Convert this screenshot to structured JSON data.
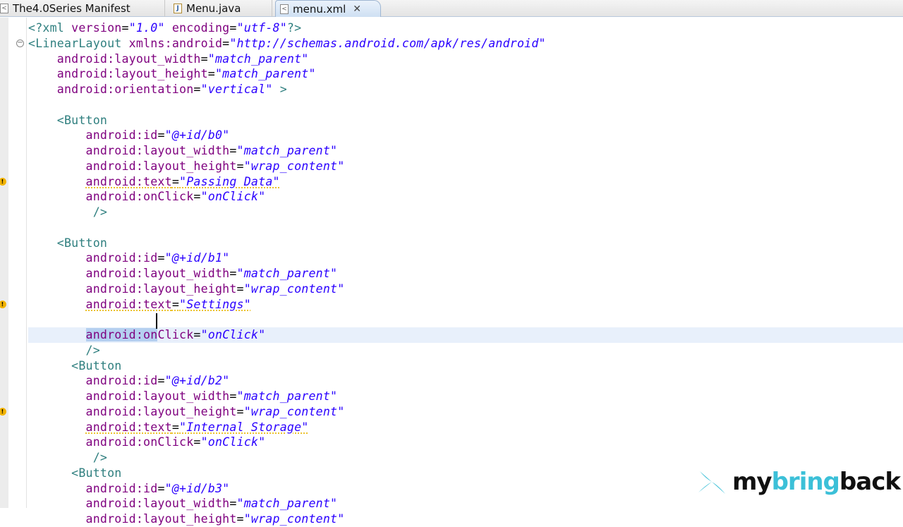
{
  "tabs": [
    {
      "label": "The4.0Series Manifest",
      "icon": "xml-file-icon"
    },
    {
      "label": "Menu.java",
      "icon": "java-file-icon"
    },
    {
      "label": "menu.xml",
      "icon": "xml-file-icon",
      "active": true
    }
  ],
  "logo": {
    "pre": "my",
    "mid": "bring",
    "post": "back"
  },
  "current_line": 20,
  "warning_lines": [
    10,
    18,
    25
  ],
  "code": [
    [
      [
        "tag",
        "<?xml "
      ],
      [
        "attr",
        "version"
      ],
      [
        "eq",
        "="
      ],
      [
        "val",
        "\"1.0\""
      ],
      [
        "attr",
        " encoding"
      ],
      [
        "eq",
        "="
      ],
      [
        "val",
        "\"utf-8\""
      ],
      [
        "tag",
        "?>"
      ]
    ],
    [
      [
        "tag",
        "<LinearLayout "
      ],
      [
        "attr",
        "xmlns:android"
      ],
      [
        "eq",
        "="
      ],
      [
        "val",
        "\"http://schemas.android.com/apk/res/android\""
      ]
    ],
    [
      [
        "sp",
        "    "
      ],
      [
        "attr",
        "android:layout_width"
      ],
      [
        "eq",
        "="
      ],
      [
        "val",
        "\"match_parent\""
      ]
    ],
    [
      [
        "sp",
        "    "
      ],
      [
        "attr",
        "android:layout_height"
      ],
      [
        "eq",
        "="
      ],
      [
        "val",
        "\"match_parent\""
      ]
    ],
    [
      [
        "sp",
        "    "
      ],
      [
        "attr",
        "android:orientation"
      ],
      [
        "eq",
        "="
      ],
      [
        "val",
        "\"vertical\""
      ],
      [
        "tag",
        " >"
      ]
    ],
    [],
    [
      [
        "sp",
        "    "
      ],
      [
        "tag",
        "<Button"
      ]
    ],
    [
      [
        "sp",
        "        "
      ],
      [
        "attr",
        "android:id"
      ],
      [
        "eq",
        "="
      ],
      [
        "val",
        "\"@+id/b0\""
      ]
    ],
    [
      [
        "sp",
        "        "
      ],
      [
        "attr",
        "android:layout_width"
      ],
      [
        "eq",
        "="
      ],
      [
        "val",
        "\"match_parent\""
      ]
    ],
    [
      [
        "sp",
        "        "
      ],
      [
        "attr",
        "android:layout_height"
      ],
      [
        "eq",
        "="
      ],
      [
        "val",
        "\"wrap_content\""
      ]
    ],
    [
      [
        "sp",
        "        "
      ],
      [
        "attrw",
        "android:text"
      ],
      [
        "eqw",
        "="
      ],
      [
        "valw",
        "\"Passing Data\""
      ]
    ],
    [
      [
        "sp",
        "        "
      ],
      [
        "attr",
        "android:onClick"
      ],
      [
        "eq",
        "="
      ],
      [
        "val",
        "\"onClick\""
      ]
    ],
    [
      [
        "sp",
        "         "
      ],
      [
        "tag",
        "/>"
      ]
    ],
    [],
    [
      [
        "sp",
        "    "
      ],
      [
        "tag",
        "<Button"
      ]
    ],
    [
      [
        "sp",
        "        "
      ],
      [
        "attr",
        "android:id"
      ],
      [
        "eq",
        "="
      ],
      [
        "val",
        "\"@+id/b1\""
      ]
    ],
    [
      [
        "sp",
        "        "
      ],
      [
        "attr",
        "android:layout_width"
      ],
      [
        "eq",
        "="
      ],
      [
        "val",
        "\"match_parent\""
      ]
    ],
    [
      [
        "sp",
        "        "
      ],
      [
        "attr",
        "android:layout_height"
      ],
      [
        "eq",
        "="
      ],
      [
        "val",
        "\"wrap_content\""
      ]
    ],
    [
      [
        "sp",
        "        "
      ],
      [
        "attrw",
        "android:text"
      ],
      [
        "eqw",
        "="
      ],
      [
        "valw",
        "\"Settings\""
      ]
    ],
    [],
    [
      [
        "sp",
        "        "
      ],
      [
        "sel",
        "android:on"
      ],
      [
        "attr",
        "Click"
      ],
      [
        "eq",
        "="
      ],
      [
        "val",
        "\"onClick\""
      ]
    ],
    [
      [
        "sp",
        "        "
      ],
      [
        "tag",
        "/>"
      ]
    ],
    [
      [
        "sp",
        "      "
      ],
      [
        "tag",
        "<Button"
      ]
    ],
    [
      [
        "sp",
        "        "
      ],
      [
        "attr",
        "android:id"
      ],
      [
        "eq",
        "="
      ],
      [
        "val",
        "\"@+id/b2\""
      ]
    ],
    [
      [
        "sp",
        "        "
      ],
      [
        "attr",
        "android:layout_width"
      ],
      [
        "eq",
        "="
      ],
      [
        "val",
        "\"match_parent\""
      ]
    ],
    [
      [
        "sp",
        "        "
      ],
      [
        "attr",
        "android:layout_height"
      ],
      [
        "eq",
        "="
      ],
      [
        "val",
        "\"wrap_content\""
      ]
    ],
    [
      [
        "sp",
        "        "
      ],
      [
        "attrw",
        "android:text"
      ],
      [
        "eqw",
        "="
      ],
      [
        "valw",
        "\"Internal Storage\""
      ]
    ],
    [
      [
        "sp",
        "        "
      ],
      [
        "attr",
        "android:onClick"
      ],
      [
        "eq",
        "="
      ],
      [
        "val",
        "\"onClick\""
      ]
    ],
    [
      [
        "sp",
        "         "
      ],
      [
        "tag",
        "/>"
      ]
    ],
    [
      [
        "sp",
        "      "
      ],
      [
        "tag",
        "<Button"
      ]
    ],
    [
      [
        "sp",
        "        "
      ],
      [
        "attr",
        "android:id"
      ],
      [
        "eq",
        "="
      ],
      [
        "val",
        "\"@+id/b3\""
      ]
    ],
    [
      [
        "sp",
        "        "
      ],
      [
        "attr",
        "android:layout_width"
      ],
      [
        "eq",
        "="
      ],
      [
        "val",
        "\"match_parent\""
      ]
    ],
    [
      [
        "sp",
        "        "
      ],
      [
        "attr",
        "android:layout_height"
      ],
      [
        "eq",
        "="
      ],
      [
        "val",
        "\"wrap_content\""
      ]
    ]
  ]
}
